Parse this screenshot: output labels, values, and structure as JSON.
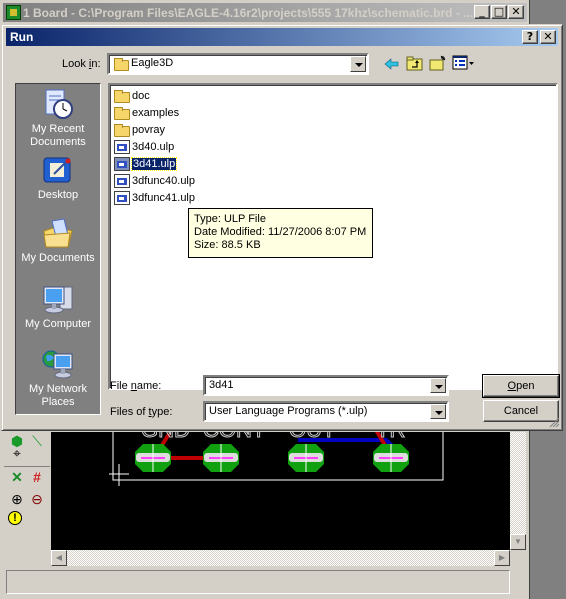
{
  "main_window": {
    "title": "1 Board - C:\\Program Files\\EAGLE-4.16r2\\projects\\555 17khz\\schematic.brd - ...",
    "buttons": {
      "minimize": "_",
      "maximize": "□",
      "close": "✕"
    },
    "pcb_labels": [
      "GND",
      "CONT",
      "OUT",
      "TR"
    ]
  },
  "dialog": {
    "title": "Run",
    "help_button": "?",
    "close_button": "✕",
    "look_in": {
      "label_prefix": "Look ",
      "label_mnemonic": "i",
      "label_suffix": "n:",
      "value": "Eagle3D"
    },
    "toolbar": {
      "back": "back-icon",
      "up_folder": "up-folder-icon",
      "new_folder": "new-folder-icon",
      "view_menu": "view-menu-icon"
    },
    "places": [
      {
        "label_1": "My Recent",
        "label_2": "Documents",
        "icon": "recent-documents-icon"
      },
      {
        "label_1": "Desktop",
        "label_2": "",
        "icon": "desktop-icon"
      },
      {
        "label_1": "My Documents",
        "label_2": "",
        "icon": "my-documents-icon"
      },
      {
        "label_1": "My Computer",
        "label_2": "",
        "icon": "my-computer-icon"
      },
      {
        "label_1": "My Network",
        "label_2": "Places",
        "icon": "network-places-icon"
      }
    ],
    "files": [
      {
        "name": "doc",
        "type": "folder"
      },
      {
        "name": "examples",
        "type": "folder"
      },
      {
        "name": "povray",
        "type": "folder"
      },
      {
        "name": "3d40.ulp",
        "type": "ulp"
      },
      {
        "name": "3d41.ulp",
        "type": "ulp",
        "selected": true
      },
      {
        "name": "3dfunc40.ulp",
        "type": "ulp"
      },
      {
        "name": "3dfunc41.ulp",
        "type": "ulp"
      }
    ],
    "tooltip": {
      "type": "Type: ULP File",
      "date": "Date Modified: 11/27/2006 8:07 PM",
      "size": "Size: 88.5 KB"
    },
    "file_name": {
      "label_prefix": "File ",
      "label_mnemonic": "n",
      "label_suffix": "ame:",
      "value": "3d41"
    },
    "file_type": {
      "label_prefix": "Files of ",
      "label_mnemonic": "t",
      "label_suffix": "ype:",
      "value": "User Language Programs (*.ulp)"
    },
    "open_button": {
      "mnemonic": "O",
      "rest": "pen"
    },
    "cancel_button": "Cancel"
  }
}
